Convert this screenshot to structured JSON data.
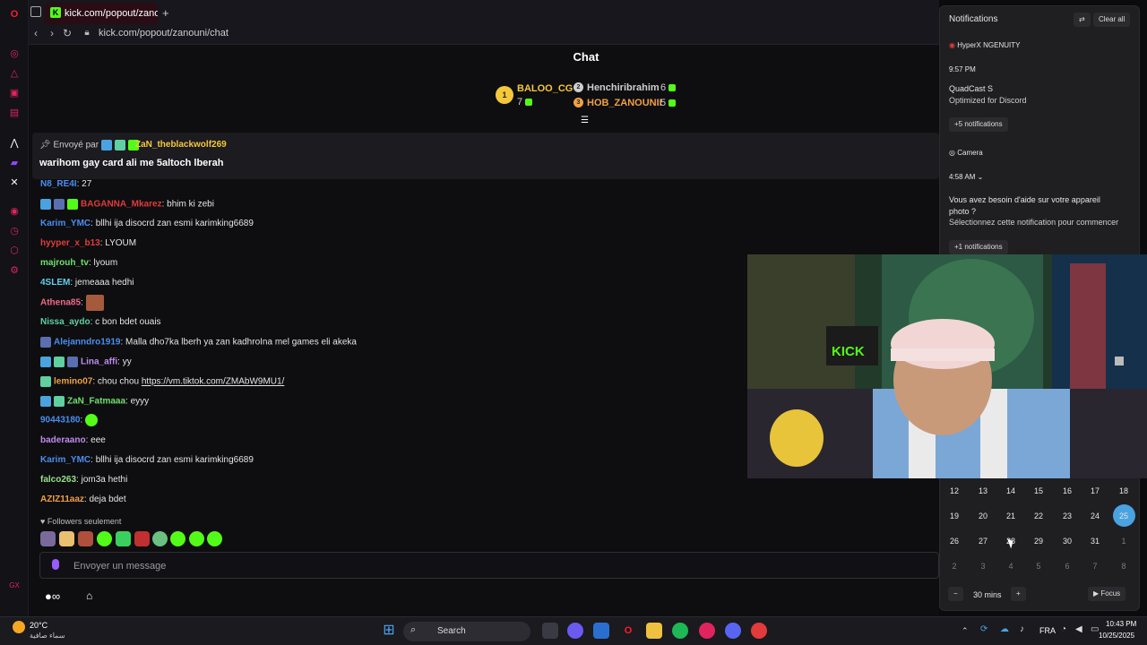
{
  "browser": {
    "tab_title": "kick.com/popout/zanouni",
    "url": "kick.com/popout/zanouni/chat",
    "add_tab": "+"
  },
  "chat": {
    "title": "Chat",
    "gifters": [
      {
        "rank": "1",
        "name": "BALOO_CG",
        "count": "7",
        "color": "#f5c83a"
      },
      {
        "rank": "2",
        "name": "Henchiribrahim",
        "count": "6",
        "color": "#cfcfcf"
      },
      {
        "rank": "3",
        "name": "HOB_ZANOUNII",
        "count": "5",
        "color": "#f0a045"
      }
    ],
    "pinned": {
      "by_label": "Envoyé par",
      "user": "ZaN_theblackwolf269",
      "text": "warihom gay card ali me 5altoch lberah"
    },
    "messages": [
      {
        "user": "BAGANNA_Mkarez",
        "color": "#e23b3b",
        "text": "bhim ki zebi"
      },
      {
        "user": "Karim_YMC",
        "color": "#4a8ef0",
        "text": "bllhi ija disocrd zan esmi karimking6689"
      },
      {
        "user": "hyyper_x_b13",
        "color": "#e23b3b",
        "text": "LYOUM"
      },
      {
        "user": "majrouh_tv",
        "color": "#6ee06e",
        "text": "lyoum"
      },
      {
        "user": "4SLEM",
        "color": "#5fd0f0",
        "text": "jemeaaa hedhi"
      },
      {
        "user": "Athena85",
        "color": "#f06a8a",
        "text": ""
      },
      {
        "user": "Nissa_aydo",
        "color": "#5fd0a0",
        "text": "c bon bdet ouais"
      },
      {
        "user": "Alejanndro1919",
        "color": "#4a8ef0",
        "text": "Malla dho7ka lberh ya zan kadhroIna mel games eli akeka"
      },
      {
        "user": "Lina_affi",
        "color": "#c08af0",
        "text": "yy"
      },
      {
        "user": "lemino07",
        "color": "#f0a045",
        "text": "chou chou",
        "link": "https://vm.tiktok.com/ZMAbW9MU1/"
      },
      {
        "user": "ZaN_Fatmaaa",
        "color": "#6ee06e",
        "text": "eyyy"
      },
      {
        "user": "90443180",
        "color": "#4a8ef0",
        "text": ""
      },
      {
        "user": "baderaano",
        "color": "#c08af0",
        "text": "eee"
      },
      {
        "user": "Karim_YMC",
        "color": "#4a8ef0",
        "text": "bllhi ija disocrd zan esmi karimking6689"
      },
      {
        "user": "falco263",
        "color": "#9ae08a",
        "text": "jom3a hethi"
      },
      {
        "user": "AZIZ11aaz",
        "color": "#f0a045",
        "text": "deja bdet"
      }
    ],
    "partial_top": {
      "user": "N8_RE4I",
      "text": "27"
    },
    "followers_label": "Followers seulement",
    "input_placeholder": "Envoyer un message"
  },
  "notifications": {
    "title": "Notifications",
    "clear_all": "Clear all",
    "app1": "HyperX NGENUITY",
    "time1": "9:57 PM",
    "n1_title": "QuadCast S",
    "n1_body": "Optimized for Discord",
    "more1": "+5 notifications",
    "app2": "Camera",
    "time2": "4:58 AM",
    "n2_line1": "Vous avez besoin d'aide sur votre appareil",
    "n2_line2": "photo ?",
    "n2_line3": "Sélectionnez cette notification pour commencer",
    "more2": "+1 notifications"
  },
  "calendar": {
    "rows": [
      [
        "12",
        "13",
        "14",
        "15",
        "16",
        "17",
        "18"
      ],
      [
        "19",
        "20",
        "21",
        "22",
        "23",
        "24",
        "25"
      ],
      [
        "26",
        "27",
        "28",
        "29",
        "30",
        "31",
        "1"
      ],
      [
        "2",
        "3",
        "4",
        "5",
        "6",
        "7",
        "8"
      ]
    ],
    "today": "25",
    "focus_duration": "30 mins",
    "minus": "−",
    "plus": "+",
    "focus_label": "Focus"
  },
  "webcam": {
    "sign": "KICK"
  },
  "taskbar": {
    "temp": "20°C",
    "weather": "سماء صافية",
    "search": "Search",
    "lang": "FRA",
    "time": "10:43 PM",
    "date": "10/25/2025"
  }
}
